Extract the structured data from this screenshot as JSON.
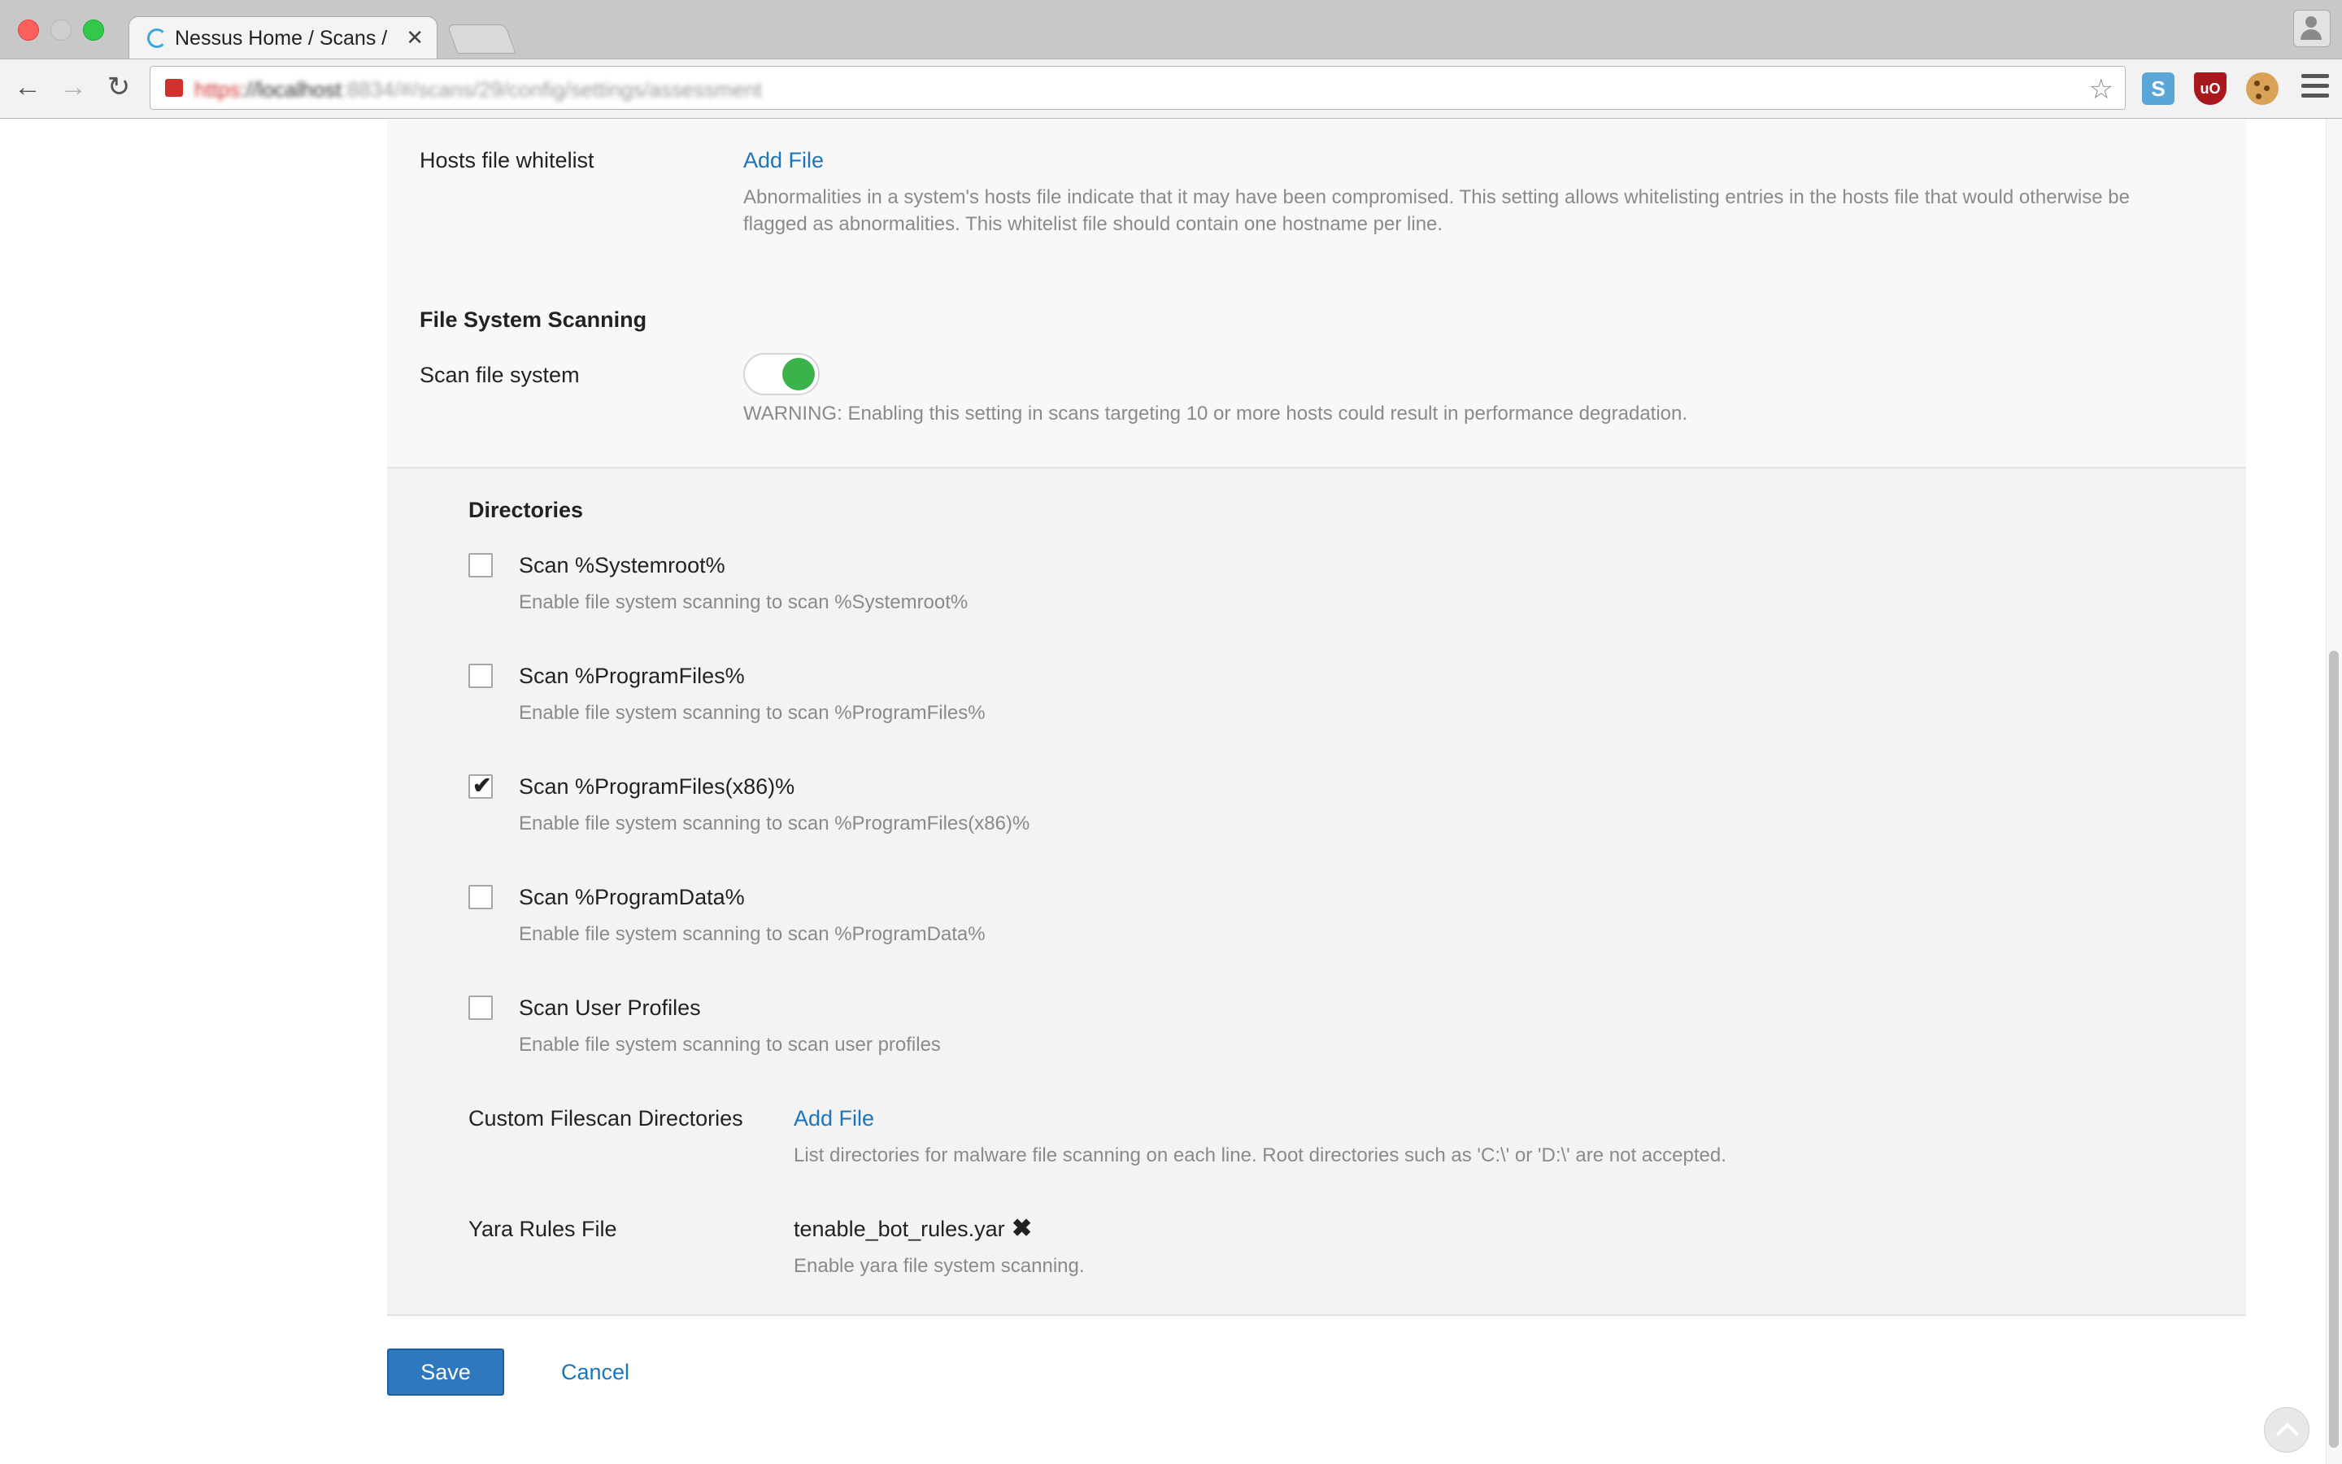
{
  "browser": {
    "tab_title": "Nessus Home / Scans / Ed",
    "tab_close": "✕",
    "url_scheme": "https",
    "url_host": "://localhost",
    "url_path": ":8834/#/scans/29/config/settings/assessment",
    "extensions": [
      "S",
      "uO"
    ]
  },
  "hosts_whitelist": {
    "label": "Hosts file whitelist",
    "action": "Add File",
    "help_line1": "Abnormalities in a system's hosts file indicate that it may have been compromised. This setting allows whitelisting entries in the hosts file that would otherwise be",
    "help_line2": "flagged as abnormalities. This whitelist file should contain one hostname per line."
  },
  "file_system_scanning": {
    "title": "File System Scanning",
    "scan_label": "Scan file system",
    "scan_enabled": true,
    "warning": "WARNING: Enabling this setting in scans targeting 10 or more hosts could result in performance degradation."
  },
  "directories": {
    "title": "Directories",
    "items": [
      {
        "label": "Scan %Systemroot%",
        "help": "Enable file system scanning to scan %Systemroot%",
        "checked": false
      },
      {
        "label": "Scan %ProgramFiles%",
        "help": "Enable file system scanning to scan %ProgramFiles%",
        "checked": false
      },
      {
        "label": "Scan %ProgramFiles(x86)%",
        "help": "Enable file system scanning to scan %ProgramFiles(x86)%",
        "checked": true
      },
      {
        "label": "Scan %ProgramData%",
        "help": "Enable file system scanning to scan %ProgramData%",
        "checked": false
      },
      {
        "label": "Scan User Profiles",
        "help": "Enable file system scanning to scan user profiles",
        "checked": false
      }
    ],
    "custom": {
      "label": "Custom Filescan Directories",
      "action": "Add File",
      "help": "List directories for malware file scanning on each line. Root directories such as 'C:\\' or 'D:\\' are not accepted."
    },
    "yara": {
      "label": "Yara Rules File",
      "filename": "tenable_bot_rules.yar",
      "remove_glyph": "✖",
      "help": "Enable yara file system scanning."
    }
  },
  "actions": {
    "save": "Save",
    "cancel": "Cancel"
  },
  "colors": {
    "accent": "#2f78bd",
    "link": "#1c74b9",
    "toggle_on": "#3bb34a"
  }
}
